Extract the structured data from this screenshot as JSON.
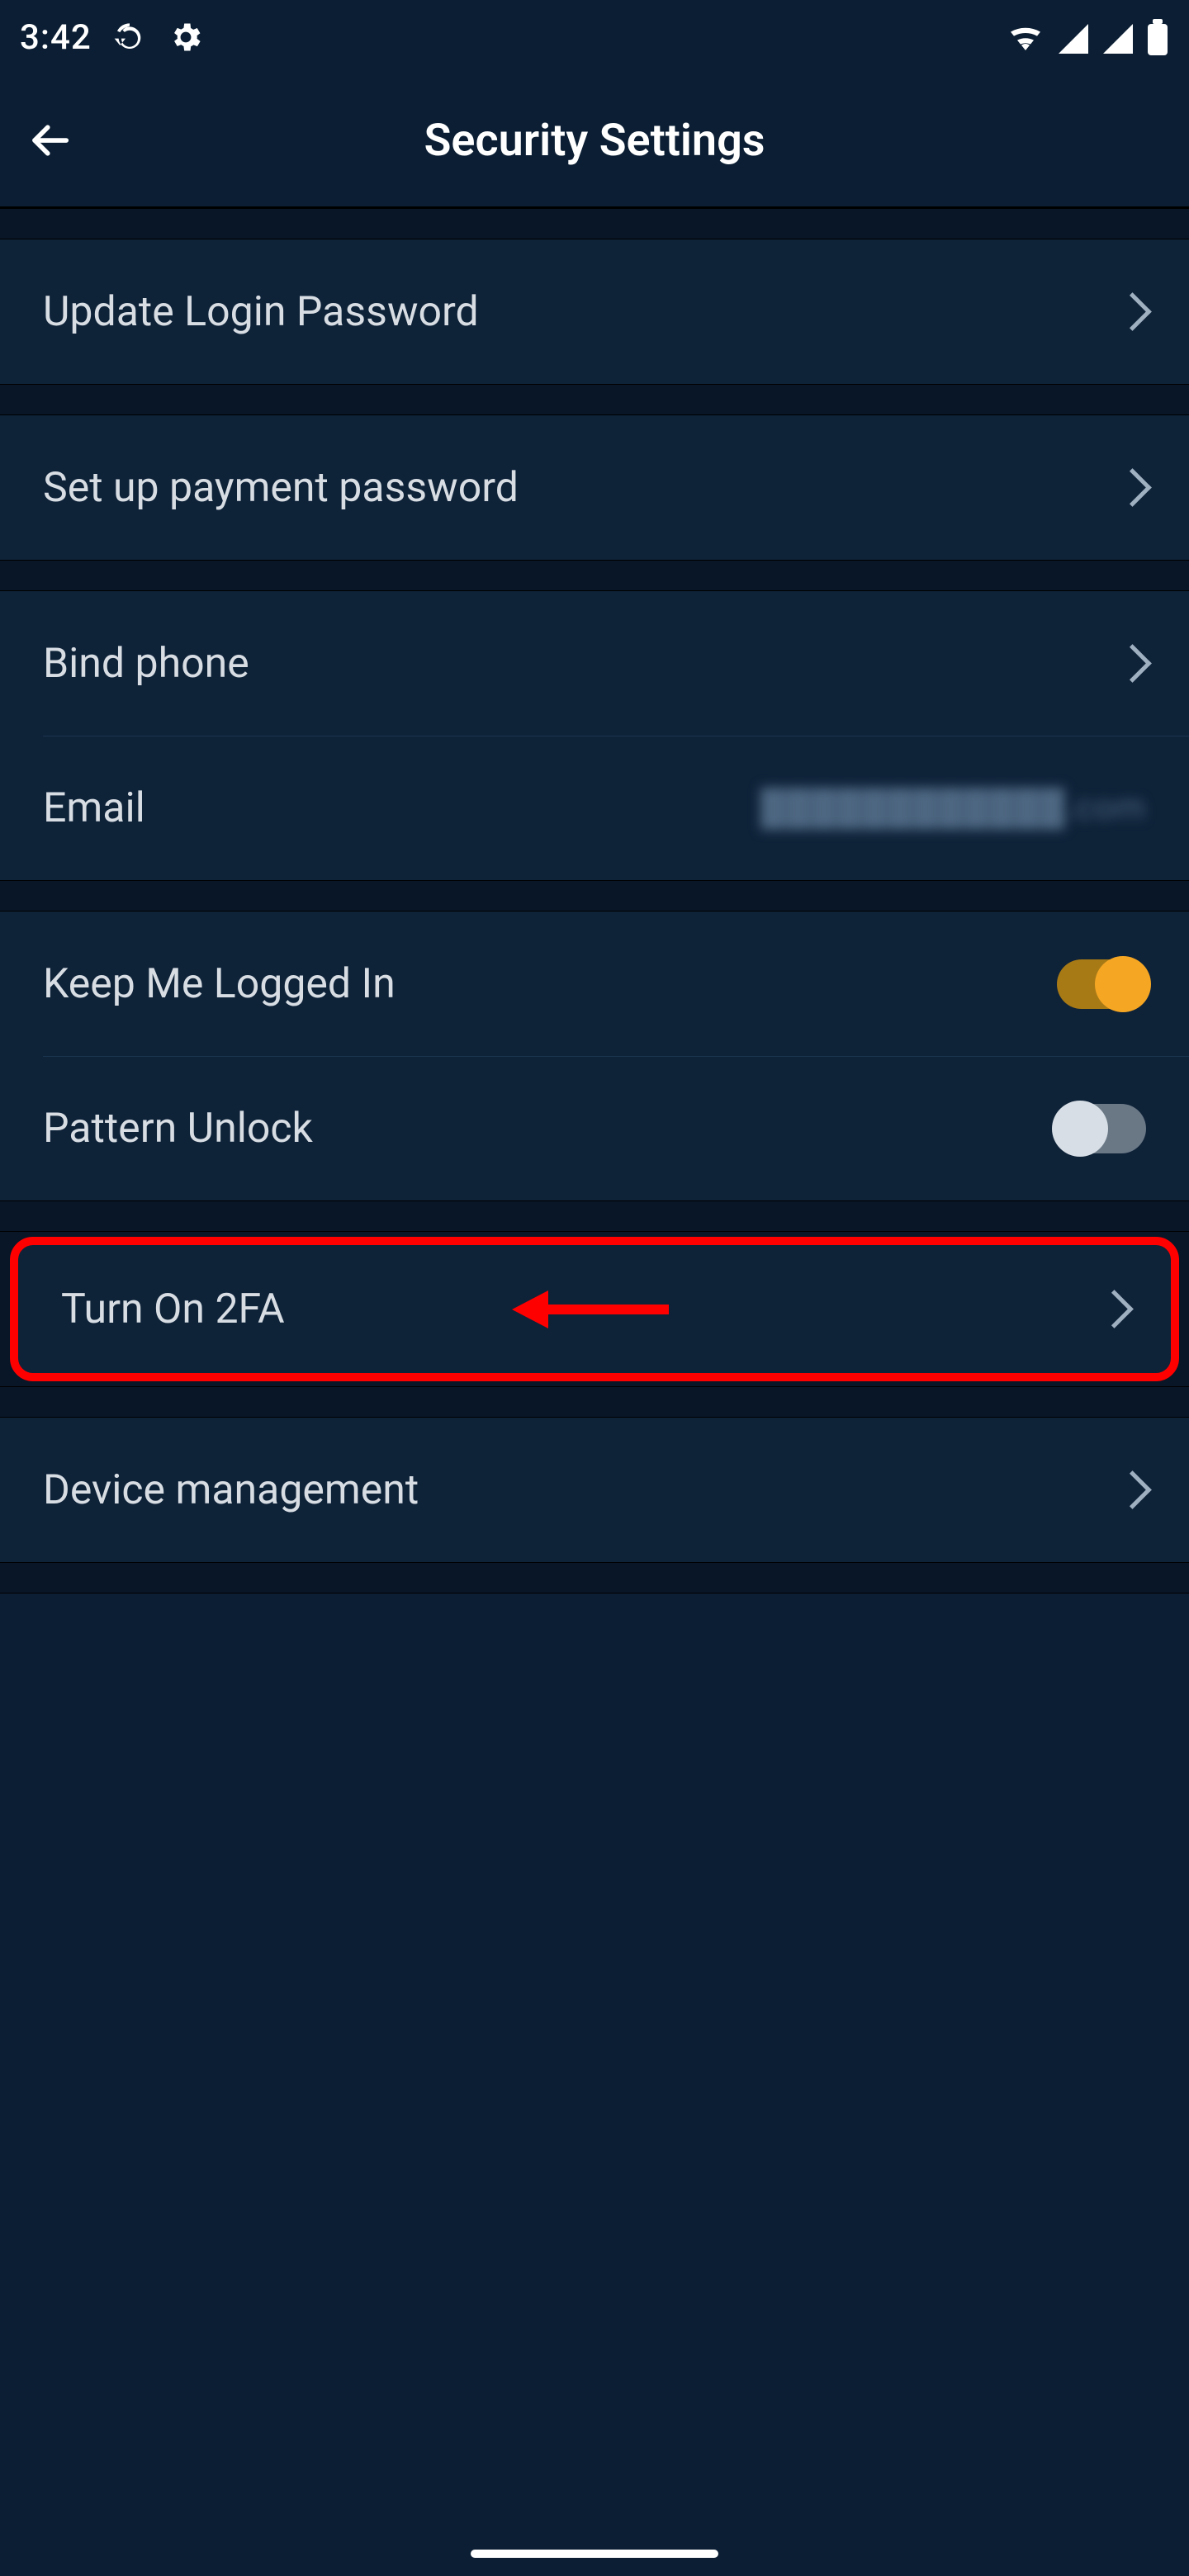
{
  "status": {
    "clock": "3:42"
  },
  "header": {
    "title": "Security Settings"
  },
  "rows": {
    "login_password": {
      "label": "Update Login Password"
    },
    "payment_password": {
      "label": "Set up payment password"
    },
    "bind_phone": {
      "label": "Bind phone"
    },
    "email": {
      "label": "Email",
      "value_obscured": "████████████.com"
    },
    "keep_logged_in": {
      "label": "Keep Me Logged In",
      "toggle": true
    },
    "pattern_unlock": {
      "label": "Pattern Unlock",
      "toggle": false
    },
    "turn_on_2fa": {
      "label": "Turn On 2FA"
    },
    "device_management": {
      "label": "Device management"
    }
  },
  "annotation": {
    "highlighted_row": "turn_on_2fa"
  }
}
